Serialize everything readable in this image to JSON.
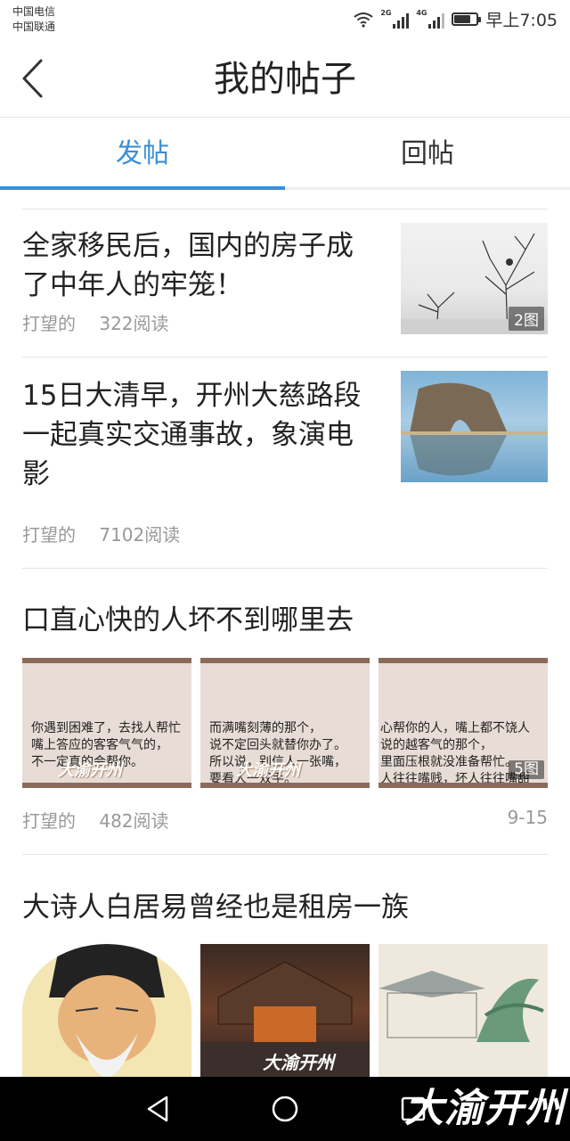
{
  "status_bar": {
    "carrier_1": "中国电信",
    "carrier_2": "中国联通",
    "sig1_tag": "2G",
    "sig2_tag": "4G",
    "time": "早上7:05"
  },
  "header": {
    "title": "我的帖子"
  },
  "tabs": [
    {
      "label": "发帖",
      "active": true
    },
    {
      "label": "回帖",
      "active": false
    }
  ],
  "posts": [
    {
      "title_line1": "全家移民后，国内的房子成",
      "title_line2": "了中年人的牢笼！",
      "author": "打望的",
      "reads": "322阅读",
      "image_count": "2图"
    },
    {
      "title_line1": "15日大清早，开州大慈路段",
      "title_line2": "一起真实交通事故，象演电",
      "title_line3": "影",
      "author": "打望的",
      "reads": "7102阅读"
    },
    {
      "title": "口直心快的人坏不到哪里去",
      "author": "打望的",
      "reads": "482阅读",
      "date": "9-15",
      "image_count": "5图",
      "cards": [
        "你遇到困难了，去找人帮忙\n嘴上答应的客客气气的，\n不一定真的会帮你。",
        "而满嘴刻薄的那个，\n说不定回头就替你办了。\n所以说，别信人一张嘴，\n要看人一双手。",
        "心帮你的人，嘴上都不饶人\n说的越客气的那个，\n里面压根就没准备帮忙。\n人往往嘴贱，坏人往往嘴甜"
      ],
      "watermark": "大渝开州"
    },
    {
      "title": "大诗人白居易曾经也是租房一族",
      "watermark": "大渝开州"
    }
  ],
  "navbar": {
    "logo": "大渝开州"
  },
  "colors": {
    "accent": "#3a8fd6"
  }
}
